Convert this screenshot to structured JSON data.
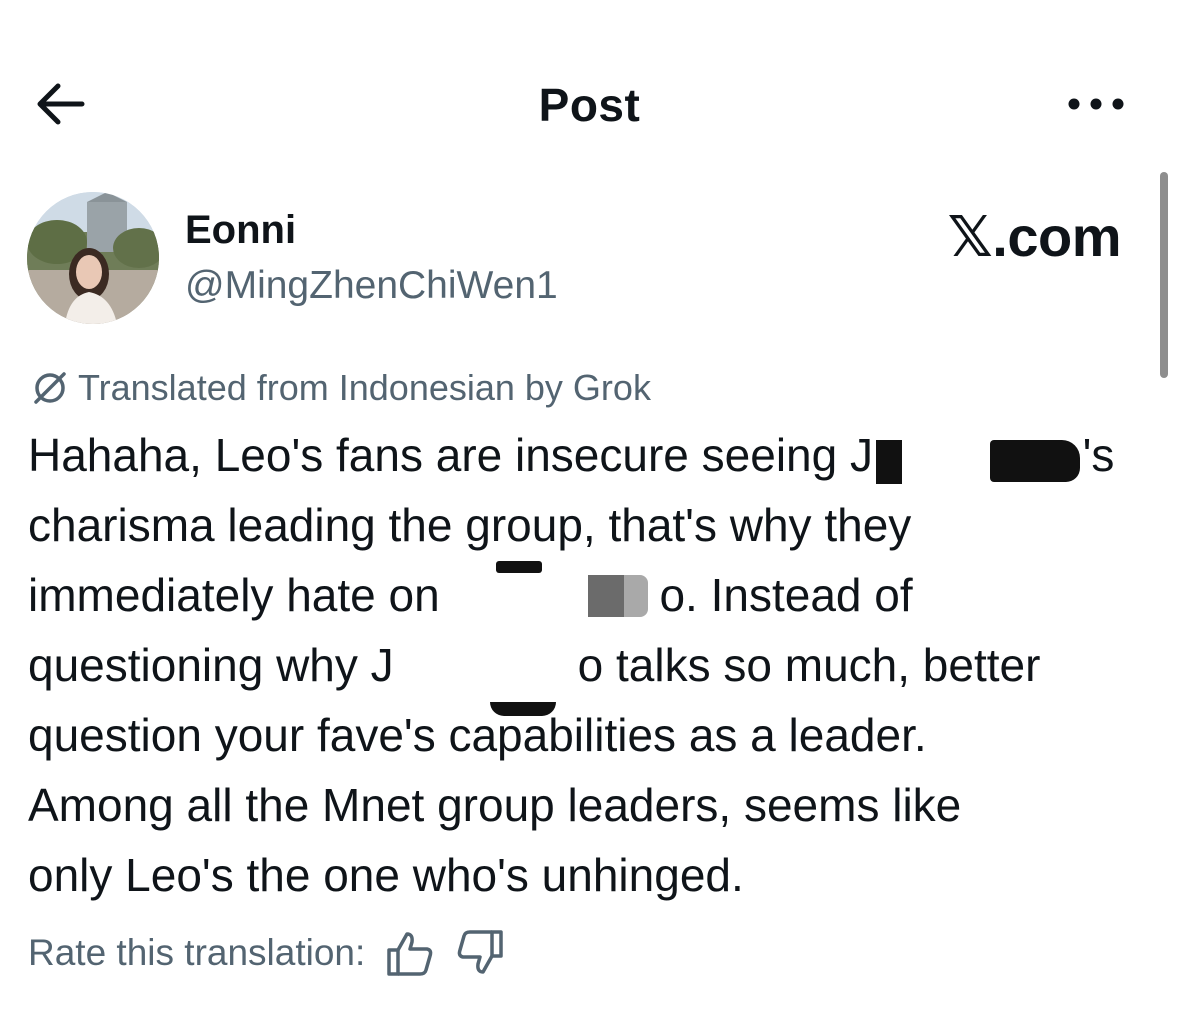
{
  "header": {
    "title": "Post",
    "back_icon": "arrow-left-icon",
    "more_icon": "more-horizontal-icon"
  },
  "author": {
    "display_name": "Eonni",
    "handle": "@MingZhenChiWen1"
  },
  "watermark": "𝕏.com",
  "translation": {
    "label": "Translated from Indonesian by Grok",
    "icon": "grok-icon"
  },
  "tweet": {
    "lines": [
      "Hahaha, Leo's fans are insecure seeing J    o's",
      "charisma leading the group, that's why they",
      "immediately hate on J    o. Instead of",
      "questioning why J    o talks so much, better",
      "question your fave's capabilities as a leader.",
      "Among all the Mnet group leaders, seems like",
      "only Leo's the one who's unhinged."
    ]
  },
  "rating": {
    "label": "Rate this translation:",
    "up_icon": "thumbs-up-icon",
    "down_icon": "thumbs-down-icon"
  },
  "colors": {
    "text_primary": "#0f1419",
    "text_secondary": "#536471",
    "background": "#ffffff"
  }
}
